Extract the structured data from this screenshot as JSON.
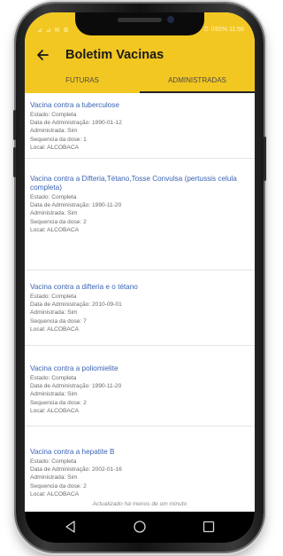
{
  "status": {
    "left": "⊿ ⊿ ✉ ⚙",
    "right": "⏱ ▯82%  11:56"
  },
  "appbar": {
    "title": "Boletim Vacinas",
    "back_icon": "arrow-left-icon"
  },
  "tabs": [
    {
      "label": "FUTURAS",
      "active": false
    },
    {
      "label": "ADMINISTRADAS",
      "active": true
    }
  ],
  "vaccines": [
    {
      "name": "Vacina contra a tuberculose",
      "estado": "Estado: Completa",
      "data": "Data de Administração: 1990-01-12",
      "administrada": "Administrada: Sim",
      "sequencia": "Sequencia da dose: 1",
      "local": "Local: ALCOBACA"
    },
    {
      "name": "Vacina contra a Difteria,Tétano,Tosse Convulsa (pertussis celula completa)",
      "estado": "Estado: Completa",
      "data": "Data de Administração: 1990-11-20",
      "administrada": "Administrada: Sim",
      "sequencia": "Sequencia da dose: 2",
      "local": "Local: ALCOBACA"
    },
    {
      "name": "Vacina contra a difteria e o tétano",
      "estado": "Estado: Completa",
      "data": "Data de Administração: 2010-09-01",
      "administrada": "Administrada: Sim",
      "sequencia": "Sequencia da dose: 7",
      "local": "Local: ALCOBACA"
    },
    {
      "name": "Vacina contra a poliomielite",
      "estado": "Estado: Completa",
      "data": "Data de Administração: 1990-11-20",
      "administrada": "Administrada: Sim",
      "sequencia": "Sequencia da dose: 2",
      "local": "Local: ALCOBACA"
    },
    {
      "name": "Vacina contra a hepatite B",
      "estado": "Estado: Completa",
      "data": "Data de Administração: 2002-01-16",
      "administrada": "Administrada: Sim",
      "sequencia": "Sequencia da dose: 2",
      "local": "Local: ALCOBACA"
    }
  ],
  "footer_note": "Actualizado há menos de um minuto",
  "navbar": {
    "back": "triangle-back-icon",
    "home": "circle-home-icon",
    "recent": "square-recent-icon"
  },
  "colors": {
    "accent": "#f3c722",
    "link": "#3a63b3",
    "text_secondary": "#6a6a6a"
  }
}
